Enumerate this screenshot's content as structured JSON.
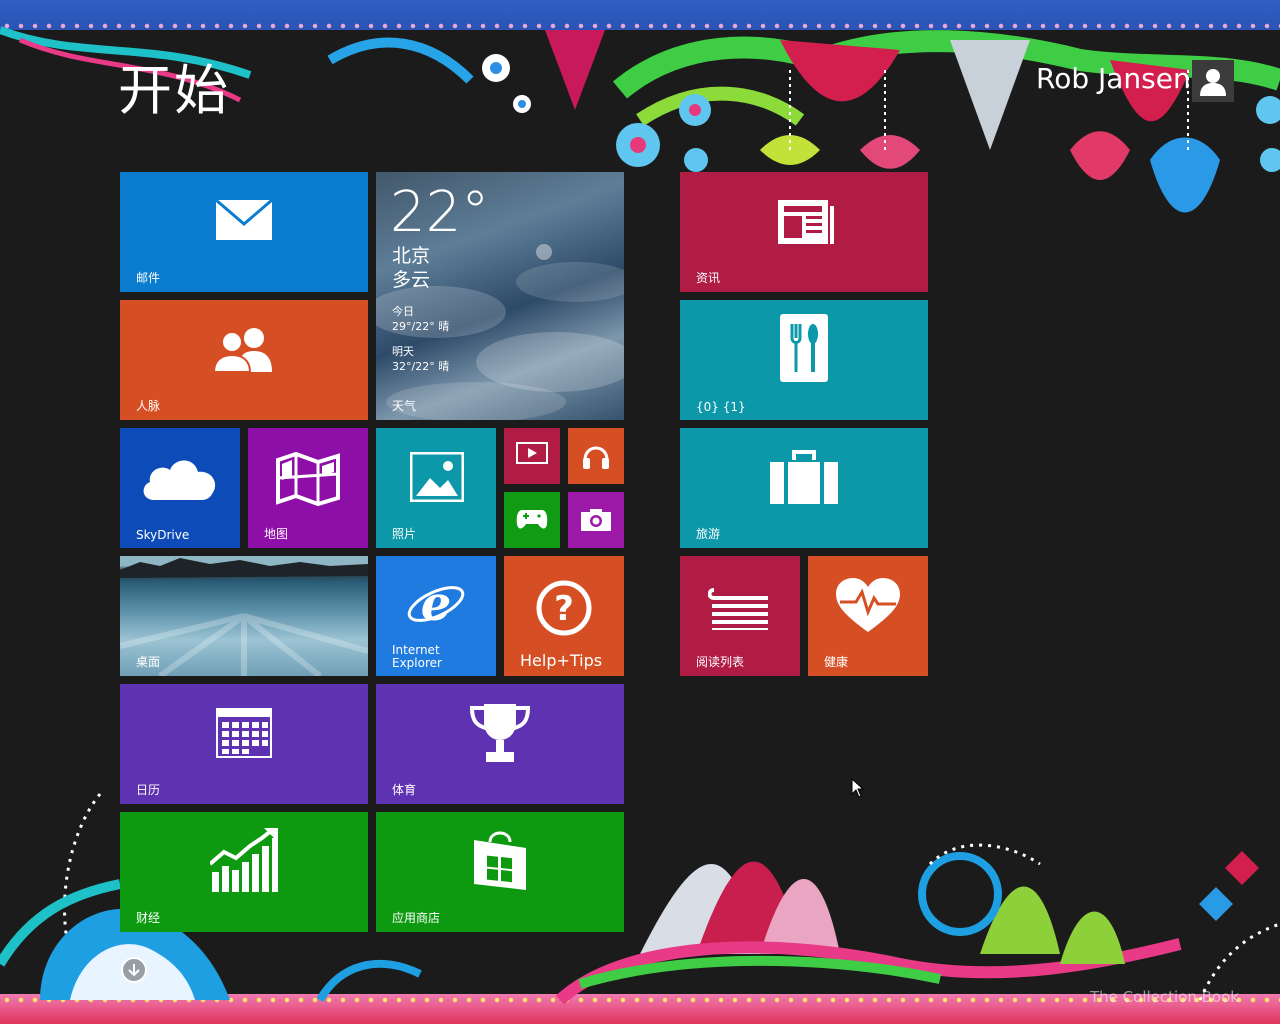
{
  "header": {
    "start_title": "开始",
    "user_name": "Rob Jansen"
  },
  "tiles": {
    "mail": "邮件",
    "weather": {
      "temp": "22°",
      "city": "北京",
      "condition": "多云",
      "today_label": "今日",
      "today_forecast": "29°/22° 晴",
      "tomorrow_label": "明天",
      "tomorrow_forecast": "32°/22° 晴",
      "label": "天气"
    },
    "news": "资讯",
    "people": "人脉",
    "food": "{0} {1}",
    "skydrive": "SkyDrive",
    "maps": "地图",
    "photos": "照片",
    "travel": "旅游",
    "desktop": "桌面",
    "ie": "Internet\nExplorer",
    "help": "Help+Tips",
    "reading_list": "阅读列表",
    "health": "健康",
    "calendar": "日历",
    "sports": "体育",
    "finance": "财经",
    "store": "应用商店"
  },
  "watermark": "The Collection Book",
  "colors": {
    "mail": "#0a7dd0",
    "people": "#d64f24",
    "news": "#b11c45",
    "food": "#0c98a8",
    "skydrive": "#0d4cb8",
    "maps": "#8e0fa8",
    "photos": "#0c98a8",
    "video": "#b11c45",
    "music": "#d64f24",
    "games": "#119b14",
    "camera": "#9d1aa8",
    "travel": "#0c98a8",
    "ie": "#1f7be0",
    "help": "#d64f24",
    "reading": "#b11c45",
    "health": "#d64f24",
    "calendar": "#5f32b2",
    "sports": "#5f32b2",
    "finance": "#0e9a10",
    "store": "#0e9a10"
  }
}
